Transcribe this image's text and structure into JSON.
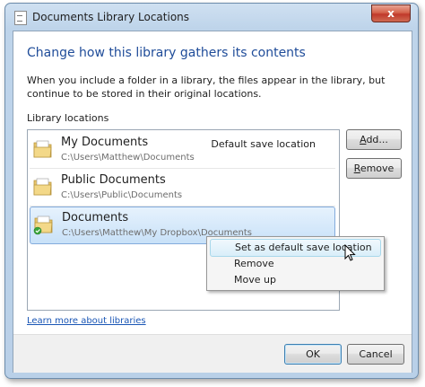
{
  "window": {
    "title": "Documents Library Locations",
    "close_label": "x"
  },
  "dialog": {
    "heading": "Change how this library gathers its contents",
    "description": "When you include a folder in a library, the files appear in the library, but continue to be stored in their original locations.",
    "locations_label": "Library locations",
    "locations": [
      {
        "name": "My Documents",
        "path": "C:\\Users\\Matthew\\Documents",
        "badge": "Default save location",
        "icon": "folder-icon"
      },
      {
        "name": "Public Documents",
        "path": "C:\\Users\\Public\\Documents",
        "badge": "",
        "icon": "folder-icon"
      },
      {
        "name": "Documents",
        "path": "C:\\Users\\Matthew\\My Dropbox\\Documents",
        "badge": "",
        "icon": "dropbox-folder-icon",
        "selected": true
      }
    ],
    "add_label_prefix": "",
    "add_label_ul": "A",
    "add_label_rest": "dd...",
    "remove_label_ul": "R",
    "remove_label_rest": "emove",
    "learn_more": "Learn more about libraries",
    "ok_label": "OK",
    "cancel_label": "Cancel"
  },
  "context_menu": {
    "items": [
      {
        "label": "Set as default save location",
        "hover": true
      },
      {
        "label": "Remove",
        "hover": false
      },
      {
        "label": "Move up",
        "hover": false
      }
    ]
  },
  "colors": {
    "heading": "#1f4c99",
    "link": "#1a56b5",
    "selection": "#c8e1f8"
  }
}
